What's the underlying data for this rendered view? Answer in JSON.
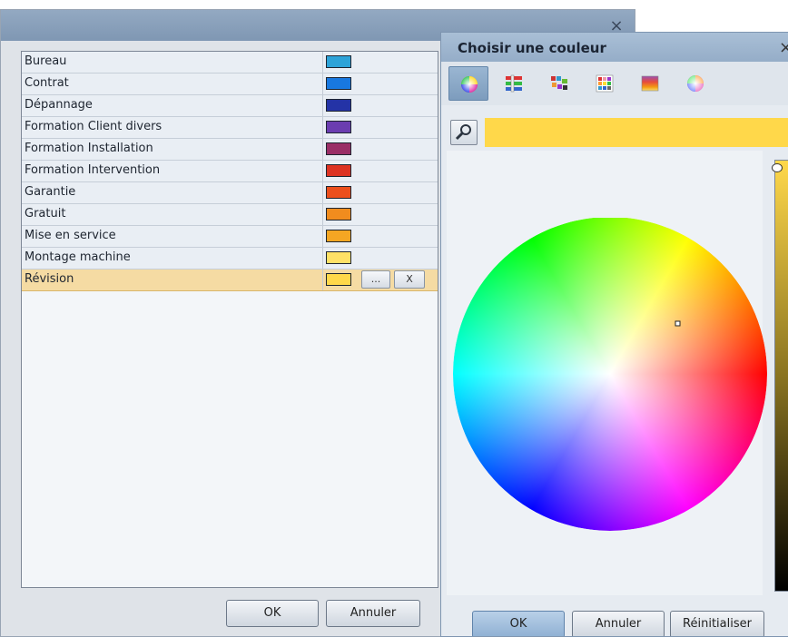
{
  "colors": {
    "preview": "#ffd84a",
    "selected_row": "#f5dba3"
  },
  "list": {
    "items": [
      {
        "label": "Bureau",
        "color": "#2da3d8"
      },
      {
        "label": "Contrat",
        "color": "#1878e0"
      },
      {
        "label": "Dépannage",
        "color": "#2433a6"
      },
      {
        "label": "Formation Client divers",
        "color": "#6b3db0"
      },
      {
        "label": "Formation Installation",
        "color": "#9a2e66"
      },
      {
        "label": "Formation Intervention",
        "color": "#dd3322"
      },
      {
        "label": "Garantie",
        "color": "#ec4f1c"
      },
      {
        "label": "Gratuit",
        "color": "#f18c1e"
      },
      {
        "label": "Mise en service",
        "color": "#f5a623"
      },
      {
        "label": "Montage machine",
        "color": "#ffe166"
      },
      {
        "label": "Révision",
        "color": "#ffd84a",
        "selected": true
      }
    ],
    "browse_label": "...",
    "clear_label": "X"
  },
  "main_dialog": {
    "close_glyph": "×",
    "ok_label": "OK",
    "cancel_label": "Annuler"
  },
  "color_picker": {
    "title": "Choisir une couleur",
    "close_glyph": "×",
    "toolbar": [
      {
        "name": "color-wheel-tab",
        "icon": "color-wheel-icon",
        "active": true
      },
      {
        "name": "sliders-tab",
        "icon": "sliders-icon",
        "active": false
      },
      {
        "name": "color-names-tab",
        "icon": "color-names-icon",
        "active": false
      },
      {
        "name": "palette-grid-tab",
        "icon": "palette-grid-icon",
        "active": false
      },
      {
        "name": "gradient-tab",
        "icon": "gradient-icon",
        "active": false
      },
      {
        "name": "hsv-circle-tab",
        "icon": "hsv-circle-icon",
        "active": false
      }
    ],
    "ok_label": "OK",
    "cancel_label": "Annuler",
    "reset_label": "Réinitialiser"
  }
}
